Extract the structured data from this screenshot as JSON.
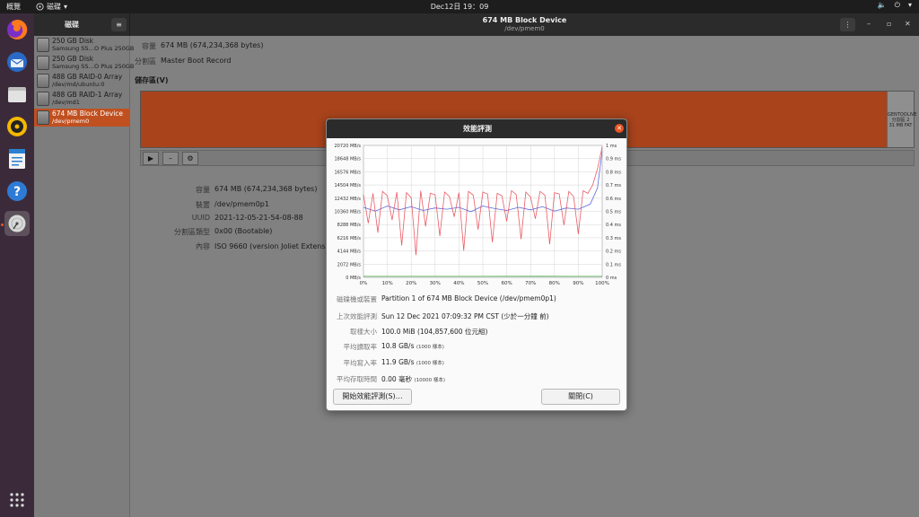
{
  "topbar": {
    "activities": "概覽",
    "app_name": "磁碟",
    "clock": "Dec12日  19：09"
  },
  "header": {
    "sidebar_title": "磁碟",
    "title": "674 MB Block Device",
    "subtitle": "/dev/pmem0"
  },
  "sidebar": {
    "drives": [
      {
        "name": "250 GB Disk",
        "sub": "Samsung SS…O Plus 250GB"
      },
      {
        "name": "250 GB Disk",
        "sub": "Samsung SS…O Plus 250GB"
      },
      {
        "name": "488 GB RAID-0 Array",
        "sub": "/dev/md/ubuntu:0"
      },
      {
        "name": "488 GB RAID-1 Array",
        "sub": "/dev/md1"
      },
      {
        "name": "674 MB Block Device",
        "sub": "/dev/pmem0"
      }
    ]
  },
  "device": {
    "size_label": "容量",
    "size_value": "674 MB (674,234,368 bytes)",
    "partitioning_label": "分割區",
    "partitioning_value": "Master Boot Record",
    "volumes_heading": "儲存區(V)"
  },
  "volume_bar": {
    "right_label_1": "GENTOOLIVE",
    "right_label_2": "分割區 2",
    "right_label_3": "31 MB FAT"
  },
  "partition": {
    "size_label": "容量",
    "size_value": "674 MB (674,234,368 bytes)",
    "device_label": "裝置",
    "device_value": "/dev/pmem0p1",
    "uuid_label": "UUID",
    "uuid_value": "2021-12-05-21-54-08-88",
    "type_label": "分割區類型",
    "type_value": "0x00 (Bootable)",
    "contents_label": "內容",
    "contents_value": "ISO 9660 (version Joliet Extension) — 未掛載"
  },
  "dialog": {
    "title": "效能評測",
    "sample_label": "磁碟機或裝置",
    "sample_value": "Partition 1 of 674 MB Block Device (/dev/pmem0p1)",
    "last_label": "上次效能評測",
    "last_value": "Sun 12 Dec 2021 07:09:32 PM CST (少於一分鐘 前)",
    "sample_size_label": "取樣大小",
    "sample_size_value": "100.0 MiB (104,857,600 位元組)",
    "read_label": "平均讀取率",
    "read_value": "10.8 GB/s",
    "read_note": "(1000 樣本)",
    "write_label": "平均寫入率",
    "write_value": "11.9 GB/s",
    "write_note": "(1000 樣本)",
    "access_label": "平均存取時間",
    "access_value": "0.00 毫秒",
    "access_note": "(10000 樣本)",
    "start_button": "開始效能評測(S)…",
    "close_button": "關閉(C)"
  },
  "chart_data": {
    "type": "line",
    "x_ticks": [
      "0%",
      "10%",
      "20%",
      "30%",
      "40%",
      "50%",
      "60%",
      "70%",
      "80%",
      "90%",
      "100%"
    ],
    "y_left_ticks": [
      "0 MB/s",
      "2072 MB/s",
      "4144 MB/s",
      "6216 MB/s",
      "8288 MB/s",
      "10360 MB/s",
      "12432 MB/s",
      "14504 MB/s",
      "16576 MB/s",
      "18648 MB/s",
      "20720 MB/s"
    ],
    "y_right_ticks": [
      "0 ms",
      "0.1 ms",
      "0.2 ms",
      "0.3 ms",
      "0.4 ms",
      "0.5 ms",
      "0.6 ms",
      "0.7 ms",
      "0.8 ms",
      "0.9 ms",
      "1 ms"
    ],
    "xlim": [
      0,
      100
    ],
    "ylim_left": [
      0,
      20720
    ],
    "ylim_right": [
      0,
      1
    ],
    "grid": true,
    "series": [
      {
        "color": "#3a4fd6",
        "points": [
          [
            0,
            11000
          ],
          [
            5,
            10400
          ],
          [
            10,
            11200
          ],
          [
            15,
            10600
          ],
          [
            20,
            11100
          ],
          [
            25,
            10500
          ],
          [
            30,
            10900
          ],
          [
            35,
            10700
          ],
          [
            40,
            11000
          ],
          [
            45,
            10300
          ],
          [
            50,
            11200
          ],
          [
            55,
            10800
          ],
          [
            60,
            10500
          ],
          [
            65,
            11000
          ],
          [
            70,
            10600
          ],
          [
            75,
            11100
          ],
          [
            80,
            10400
          ],
          [
            85,
            10900
          ],
          [
            90,
            10700
          ],
          [
            95,
            11500
          ],
          [
            98,
            14000
          ],
          [
            100,
            19800
          ]
        ]
      },
      {
        "color": "#e8404a",
        "points": [
          [
            0,
            13000
          ],
          [
            2,
            8500
          ],
          [
            4,
            13200
          ],
          [
            6,
            7000
          ],
          [
            8,
            13500
          ],
          [
            10,
            12800
          ],
          [
            12,
            9000
          ],
          [
            14,
            13400
          ],
          [
            16,
            5000
          ],
          [
            18,
            13300
          ],
          [
            20,
            12500
          ],
          [
            22,
            3500
          ],
          [
            24,
            13600
          ],
          [
            26,
            8000
          ],
          [
            28,
            13200
          ],
          [
            30,
            13000
          ],
          [
            32,
            6500
          ],
          [
            34,
            13400
          ],
          [
            36,
            12700
          ],
          [
            38,
            9500
          ],
          [
            40,
            13300
          ],
          [
            42,
            4200
          ],
          [
            44,
            13500
          ],
          [
            46,
            12900
          ],
          [
            48,
            7500
          ],
          [
            50,
            13400
          ],
          [
            52,
            13100
          ],
          [
            54,
            5500
          ],
          [
            56,
            13200
          ],
          [
            58,
            12800
          ],
          [
            60,
            8800
          ],
          [
            62,
            13600
          ],
          [
            64,
            13000
          ],
          [
            66,
            6000
          ],
          [
            68,
            13400
          ],
          [
            70,
            12600
          ],
          [
            72,
            9200
          ],
          [
            74,
            13500
          ],
          [
            76,
            12900
          ],
          [
            78,
            5200
          ],
          [
            80,
            13300
          ],
          [
            82,
            13100
          ],
          [
            84,
            8200
          ],
          [
            86,
            13500
          ],
          [
            88,
            12700
          ],
          [
            90,
            6800
          ],
          [
            92,
            13600
          ],
          [
            94,
            13200
          ],
          [
            96,
            14500
          ],
          [
            98,
            17000
          ],
          [
            100,
            20500
          ]
        ]
      },
      {
        "color": "#2a9a2a",
        "points": [
          [
            0,
            150
          ],
          [
            25,
            160
          ],
          [
            50,
            150
          ],
          [
            75,
            170
          ],
          [
            100,
            160
          ]
        ]
      }
    ]
  }
}
